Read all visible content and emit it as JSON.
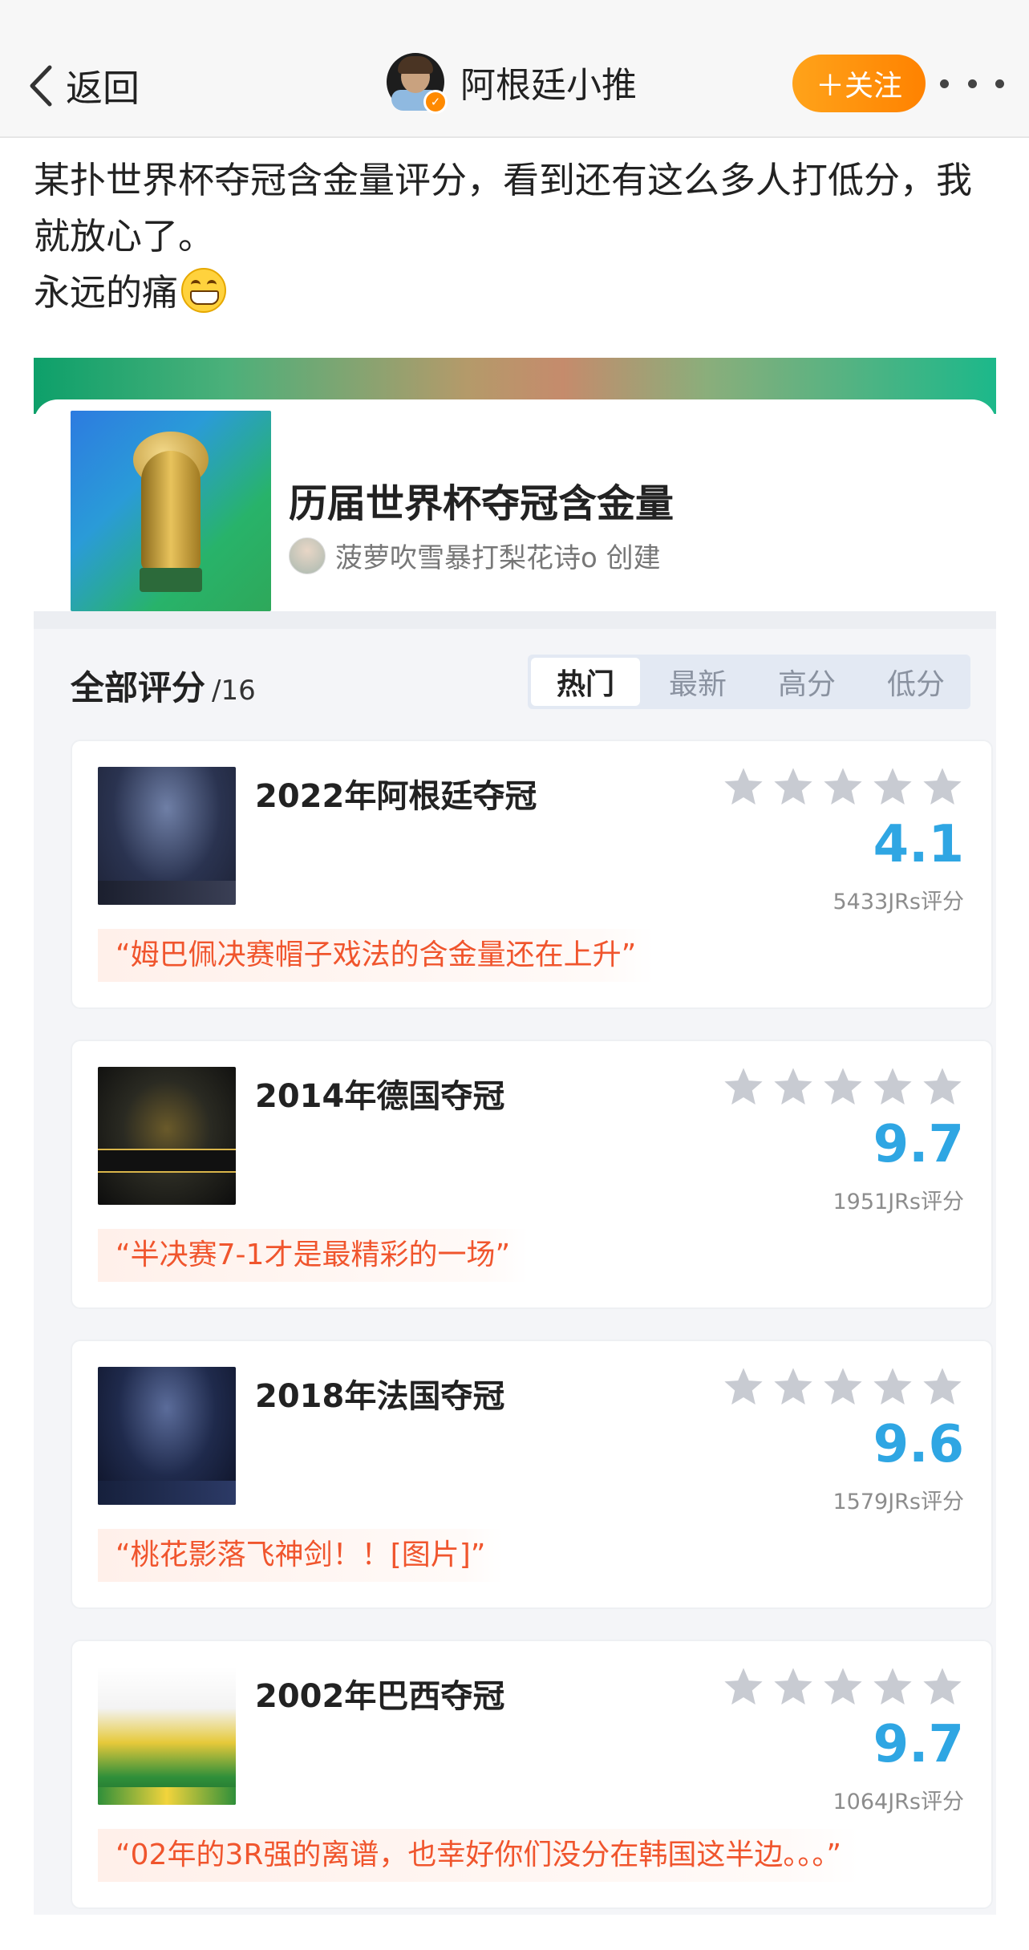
{
  "nav": {
    "back_label": "返回",
    "account_name": "阿根廷小推",
    "follow_label": "＋关注"
  },
  "post": {
    "line1": "某扑世界杯夺冠含金量评分，看到还有这么多人打低分，我就放心了。",
    "line2": "永远的痛"
  },
  "ranking": {
    "title": "历届世界杯夺冠含金量",
    "creator": "菠萝吹雪暴打梨花诗o 创建"
  },
  "ratings": {
    "heading": "全部评分",
    "count": "/16",
    "tabs": [
      "热门",
      "最新",
      "高分",
      "低分"
    ],
    "items": [
      {
        "title": "2022年阿根廷夺冠",
        "score": "4.1",
        "votes": "5433JRs评分",
        "quote": "“姆巴佩决赛帽子戏法的含金量还在上升”"
      },
      {
        "title": "2014年德国夺冠",
        "score": "9.7",
        "votes": "1951JRs评分",
        "quote": "“半决赛7-1才是最精彩的一场”"
      },
      {
        "title": "2018年法国夺冠",
        "score": "9.6",
        "votes": "1579JRs评分",
        "quote": "“桃花影落飞神剑！！[图片]”"
      },
      {
        "title": "2002年巴西夺冠",
        "score": "9.7",
        "votes": "1064JRs评分",
        "quote": "“02年的3R强的离谱，也幸好你们没分在韩国这半边。。。”"
      }
    ]
  },
  "colors": {
    "accent_orange": "#ff8c00",
    "score_blue": "#2fa6e3",
    "quote_red": "#f0552d",
    "star_grey": "#c8cbd2"
  }
}
